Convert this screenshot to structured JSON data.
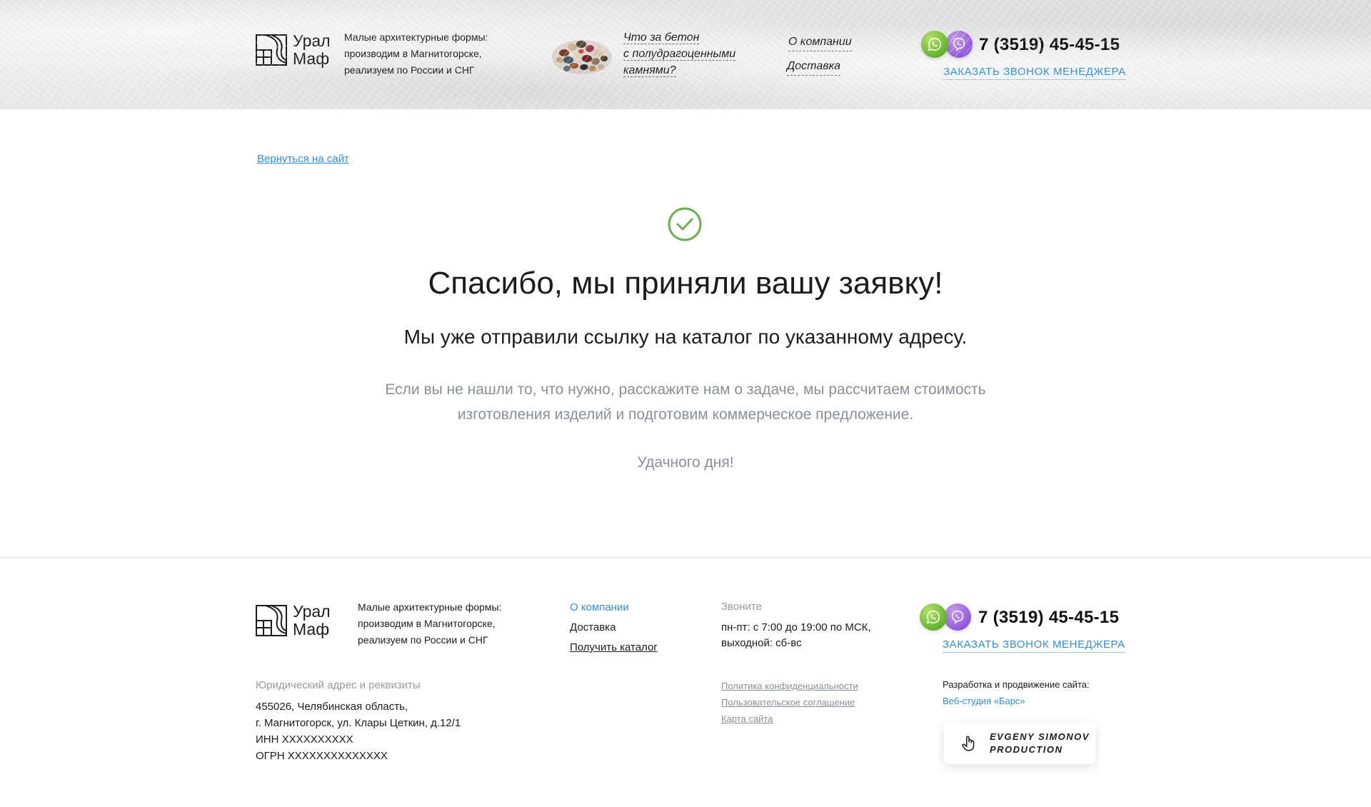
{
  "header": {
    "logo": {
      "line1": "Урал",
      "line2": "Маф"
    },
    "tagline": [
      "Малые архитектурные формы:",
      "производим в Магнитогорске,",
      "реализуем по России и СНГ"
    ],
    "promo": [
      "Что за бетон",
      "с полудрагоценными",
      "камнями?"
    ],
    "nav": {
      "about": "О компании",
      "delivery": "Доставка"
    },
    "phone": "7 (3519) 45-45-15",
    "callback": "Заказать звонок менеджера"
  },
  "main": {
    "back_link": "Вернуться на сайт",
    "title": "Спасибо, мы приняли вашу заявку!",
    "subtitle": "Мы уже отправили ссылку на каталог по указанному адресу.",
    "info_line1": "Если вы не нашли то, что нужно, расскажите нам о задаче, мы рассчитаем стоимость",
    "info_line2": "изготовления изделий и подготовим коммерческое предложение.",
    "bye": "Удачного дня!"
  },
  "footer": {
    "logo": {
      "line1": "Урал",
      "line2": "Маф"
    },
    "tagline": [
      "Малые архитектурные формы:",
      "производим в Магнитогорске,",
      "реализуем по России и СНГ"
    ],
    "nav": {
      "about": "О компании",
      "delivery": "Доставка",
      "catalog": "Получить каталог"
    },
    "call": {
      "label": "Звоните",
      "hours": "пн-пт: с 7:00 до 19:00 по МСК,",
      "weekend": "выходной: сб-вс"
    },
    "phone": "7 (3519) 45-45-15",
    "callback": "Заказать звонок менеджера",
    "legal": {
      "label": "Юридический адрес и реквизиты",
      "address1": "455026, Челябинская область,",
      "address2": "г. Магнитогорск, ул. Клары Цеткин, д.12/1",
      "inn": "ИНН XXXXXXXXXX",
      "ogrn": "ОГРН XXXXXXXXXXXXXX"
    },
    "policies": {
      "privacy": "Политика конфиденциальности",
      "agreement": "Пользовательское соглашение",
      "sitemap": "Карта сайта"
    },
    "dev": {
      "label": "Разработка и продвижение сайта:",
      "studio": "Веб-студия «Барс»"
    },
    "badge": {
      "line1": "Evgeny Simonov",
      "line2": "Production"
    }
  },
  "colors": {
    "accent": "#2d8fe0",
    "check": "#6ab04c",
    "whatsapp": "#5cb02a",
    "viber": "#8e55d8",
    "muted": "#8a8f98"
  },
  "icons": [
    "logo-mark-icon",
    "stones-image",
    "whatsapp-icon",
    "viber-icon",
    "check-circle-icon",
    "hand-pointer-icon"
  ]
}
